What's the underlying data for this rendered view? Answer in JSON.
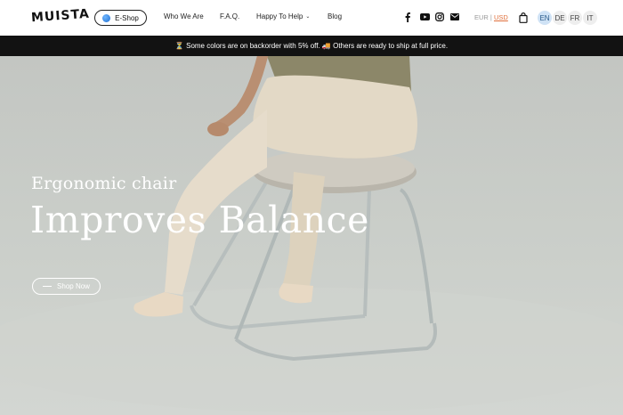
{
  "header": {
    "logo": "MUISTA",
    "eshop_label": "E-Shop",
    "nav": [
      "Who We Are",
      "F.A.Q.",
      "Happy To Help",
      "Blog"
    ],
    "social_icons": [
      "facebook-icon",
      "youtube-icon",
      "instagram-icon",
      "email-icon"
    ],
    "currency": {
      "eur": "EUR",
      "separator": " | ",
      "usd": "USD",
      "active": "USD"
    },
    "languages": [
      "EN",
      "DE",
      "FR",
      "IT"
    ],
    "active_language": "EN"
  },
  "announcement": {
    "text": "⏳ Some colors are on backorder with 5% off. 🚚 Others are ready to ship at full price."
  },
  "hero": {
    "eyebrow": "Ergonomic chair",
    "headline": "Improves Balance",
    "cta_label": "Shop Now"
  },
  "colors": {
    "announcement_bg": "#121212",
    "usd_accent": "#e0703c",
    "active_lang_bg": "#cfe2f5"
  }
}
